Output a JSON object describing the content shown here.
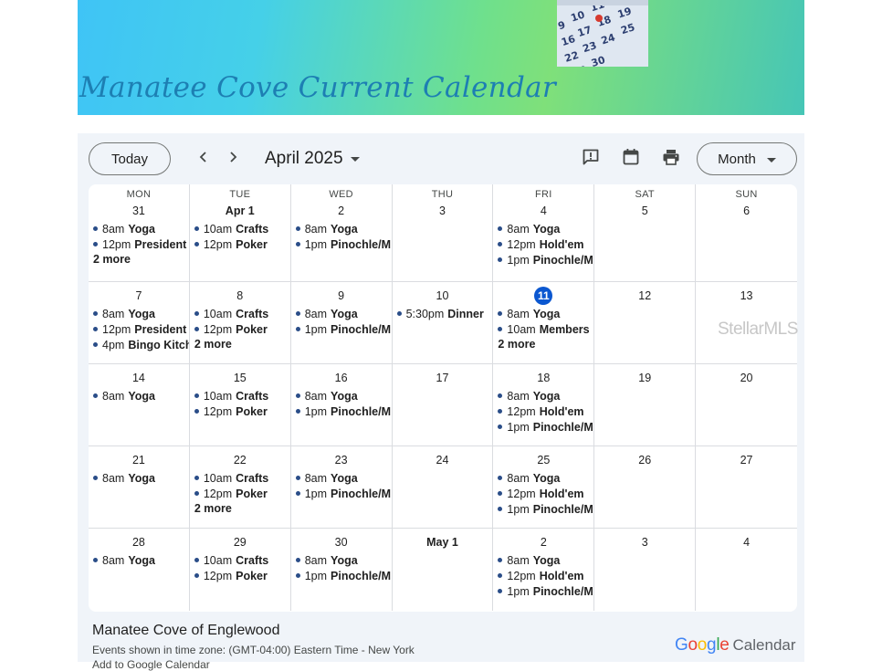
{
  "banner": {
    "title": "Manatee Cove Current Calendar"
  },
  "toolbar": {
    "today_label": "Today",
    "prev_icon": "chevron-left-icon",
    "next_icon": "chevron-right-icon",
    "month_label": "April 2025",
    "view_label": "Month"
  },
  "grid": {
    "weekdays": [
      "MON",
      "TUE",
      "WED",
      "THU",
      "FRI",
      "SAT",
      "SUN"
    ],
    "weeks": [
      [
        {
          "day": "31",
          "events": [
            {
              "time": "8am",
              "name": "Yoga"
            },
            {
              "time": "12pm",
              "name": "President"
            }
          ],
          "more": "2 more"
        },
        {
          "day": "Apr 1",
          "bold": true,
          "events": [
            {
              "time": "10am",
              "name": "Crafts"
            },
            {
              "time": "12pm",
              "name": "Poker"
            }
          ],
          "more": ""
        },
        {
          "day": "2",
          "events": [
            {
              "time": "8am",
              "name": "Yoga"
            },
            {
              "time": "1pm",
              "name": "Pinochle/M"
            }
          ],
          "more": ""
        },
        {
          "day": "3",
          "events": [],
          "more": ""
        },
        {
          "day": "4",
          "events": [
            {
              "time": "8am",
              "name": "Yoga"
            },
            {
              "time": "12pm",
              "name": "Hold'em"
            },
            {
              "time": "1pm",
              "name": "Pinochle/M"
            }
          ],
          "more": ""
        },
        {
          "day": "5",
          "events": [],
          "more": ""
        },
        {
          "day": "6",
          "events": [],
          "more": ""
        }
      ],
      [
        {
          "day": "7",
          "events": [
            {
              "time": "8am",
              "name": "Yoga"
            },
            {
              "time": "12pm",
              "name": "President"
            },
            {
              "time": "4pm",
              "name": "Bingo Kitchen"
            }
          ],
          "more": ""
        },
        {
          "day": "8",
          "events": [
            {
              "time": "10am",
              "name": "Crafts"
            },
            {
              "time": "12pm",
              "name": "Poker"
            }
          ],
          "more": "2 more"
        },
        {
          "day": "9",
          "events": [
            {
              "time": "8am",
              "name": "Yoga"
            },
            {
              "time": "1pm",
              "name": "Pinochle/M"
            }
          ],
          "more": ""
        },
        {
          "day": "10",
          "events": [
            {
              "time": "5:30pm",
              "name": "Dinner"
            }
          ],
          "more": ""
        },
        {
          "day": "11",
          "today": true,
          "events": [
            {
              "time": "8am",
              "name": "Yoga"
            },
            {
              "time": "10am",
              "name": "Members"
            }
          ],
          "more": "2 more"
        },
        {
          "day": "12",
          "events": [],
          "more": ""
        },
        {
          "day": "13",
          "events": [],
          "more": ""
        }
      ],
      [
        {
          "day": "14",
          "events": [
            {
              "time": "8am",
              "name": "Yoga"
            }
          ],
          "more": ""
        },
        {
          "day": "15",
          "events": [
            {
              "time": "10am",
              "name": "Crafts"
            },
            {
              "time": "12pm",
              "name": "Poker"
            }
          ],
          "more": ""
        },
        {
          "day": "16",
          "events": [
            {
              "time": "8am",
              "name": "Yoga"
            },
            {
              "time": "1pm",
              "name": "Pinochle/M"
            }
          ],
          "more": ""
        },
        {
          "day": "17",
          "events": [],
          "more": ""
        },
        {
          "day": "18",
          "events": [
            {
              "time": "8am",
              "name": "Yoga"
            },
            {
              "time": "12pm",
              "name": "Hold'em"
            },
            {
              "time": "1pm",
              "name": "Pinochle/M"
            }
          ],
          "more": ""
        },
        {
          "day": "19",
          "events": [],
          "more": ""
        },
        {
          "day": "20",
          "events": [],
          "more": ""
        }
      ],
      [
        {
          "day": "21",
          "events": [
            {
              "time": "8am",
              "name": "Yoga"
            }
          ],
          "more": ""
        },
        {
          "day": "22",
          "events": [
            {
              "time": "10am",
              "name": "Crafts"
            },
            {
              "time": "12pm",
              "name": "Poker"
            }
          ],
          "more": "2 more"
        },
        {
          "day": "23",
          "events": [
            {
              "time": "8am",
              "name": "Yoga"
            },
            {
              "time": "1pm",
              "name": "Pinochle/M"
            }
          ],
          "more": ""
        },
        {
          "day": "24",
          "events": [],
          "more": ""
        },
        {
          "day": "25",
          "events": [
            {
              "time": "8am",
              "name": "Yoga"
            },
            {
              "time": "12pm",
              "name": "Hold'em"
            },
            {
              "time": "1pm",
              "name": "Pinochle/M"
            }
          ],
          "more": ""
        },
        {
          "day": "26",
          "events": [],
          "more": ""
        },
        {
          "day": "27",
          "events": [],
          "more": ""
        }
      ],
      [
        {
          "day": "28",
          "events": [
            {
              "time": "8am",
              "name": "Yoga"
            }
          ],
          "more": ""
        },
        {
          "day": "29",
          "events": [
            {
              "time": "10am",
              "name": "Crafts"
            },
            {
              "time": "12pm",
              "name": "Poker"
            }
          ],
          "more": ""
        },
        {
          "day": "30",
          "events": [
            {
              "time": "8am",
              "name": "Yoga"
            },
            {
              "time": "1pm",
              "name": "Pinochle/M"
            }
          ],
          "more": ""
        },
        {
          "day": "May 1",
          "bold": true,
          "events": [],
          "more": ""
        },
        {
          "day": "2",
          "events": [
            {
              "time": "8am",
              "name": "Yoga"
            },
            {
              "time": "12pm",
              "name": "Hold'em"
            },
            {
              "time": "1pm",
              "name": "Pinochle/M"
            }
          ],
          "more": ""
        },
        {
          "day": "3",
          "events": [],
          "more": ""
        },
        {
          "day": "4",
          "events": [],
          "more": ""
        }
      ]
    ]
  },
  "watermark": "StellarMLS",
  "footer": {
    "calendar_name": "Manatee Cove of Englewood",
    "timezone": "Events shown in time zone: (GMT-04:00) Eastern Time - New York",
    "add_link": "Add to Google Calendar",
    "google": [
      "G",
      "o",
      "o",
      "g",
      "l",
      "e"
    ],
    "calendar_word": "Calendar"
  },
  "colors": {
    "event_dot": "#2a4d88",
    "today": "#0b57d0",
    "google": [
      "#4285F4",
      "#EA4335",
      "#FBBC05",
      "#4285F4",
      "#34A853",
      "#EA4335"
    ]
  }
}
